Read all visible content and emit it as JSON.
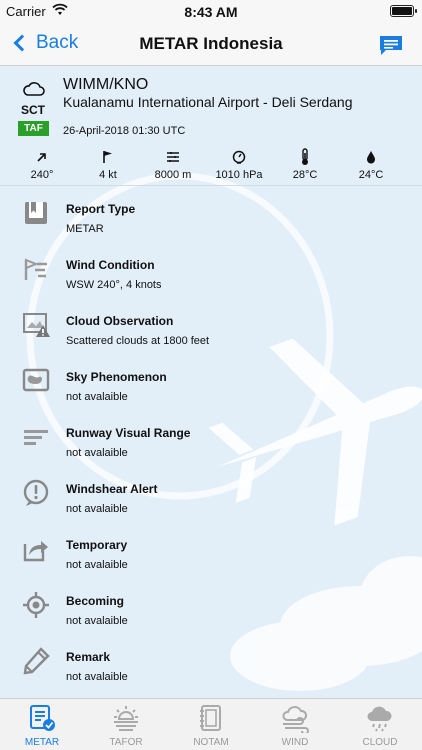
{
  "status_bar": {
    "carrier": "Carrier",
    "time": "8:43 AM"
  },
  "nav": {
    "back_label": "Back",
    "title": "METAR Indonesia",
    "chat_icon": "chat-icon"
  },
  "station": {
    "cloud_cover": "SCT",
    "taf_label": "TAF",
    "code": "WIMM/KNO",
    "name": "Kualanamu International Airport - Deli Serdang",
    "time": "26-April-2018 01:30 UTC"
  },
  "metrics": [
    {
      "icon": "wind-direction-icon",
      "value": "240°"
    },
    {
      "icon": "flag-icon",
      "value": "4 kt"
    },
    {
      "icon": "visibility-icon",
      "value": "8000 m"
    },
    {
      "icon": "pressure-gauge-icon",
      "value": "1010 hPa"
    },
    {
      "icon": "thermometer-icon",
      "value": "28°C"
    },
    {
      "icon": "dew-drop-icon",
      "value": "24°C"
    }
  ],
  "rows": [
    {
      "icon": "report-type-icon",
      "title": "Report Type",
      "value": "METAR"
    },
    {
      "icon": "wind-condition-icon",
      "title": "Wind Condition",
      "value": "WSW 240°, 4 knots"
    },
    {
      "icon": "cloud-observation-icon",
      "title": "Cloud Observation",
      "value": "Scattered clouds at 1800 feet"
    },
    {
      "icon": "sky-phenomenon-icon",
      "title": "Sky Phenomenon",
      "value": "not avalaible"
    },
    {
      "icon": "runway-range-icon",
      "title": "Runway Visual Range",
      "value": "not avalaible"
    },
    {
      "icon": "windshear-alert-icon",
      "title": "Windshear Alert",
      "value": "not avalaible"
    },
    {
      "icon": "temporary-icon",
      "title": "Temporary",
      "value": "not avalaible"
    },
    {
      "icon": "becoming-icon",
      "title": "Becoming",
      "value": "not avalaible"
    },
    {
      "icon": "remark-pencil-icon",
      "title": "Remark",
      "value": "not avalaible"
    }
  ],
  "tabs": [
    {
      "label": "METAR",
      "icon": "metar-report-icon",
      "active": true
    },
    {
      "label": "TAFOR",
      "icon": "tafor-sun-icon",
      "active": false
    },
    {
      "label": "NOTAM",
      "icon": "notam-notebook-icon",
      "active": false
    },
    {
      "label": "WIND",
      "icon": "wind-cloud-icon",
      "active": false
    },
    {
      "label": "CLOUD",
      "icon": "cloud-rain-icon",
      "active": false
    }
  ],
  "colors": {
    "accent": "#1a7ee0",
    "taf_badge": "#2aa02a",
    "background": "#e2eef8",
    "tab_inactive": "#9a9a9a"
  }
}
